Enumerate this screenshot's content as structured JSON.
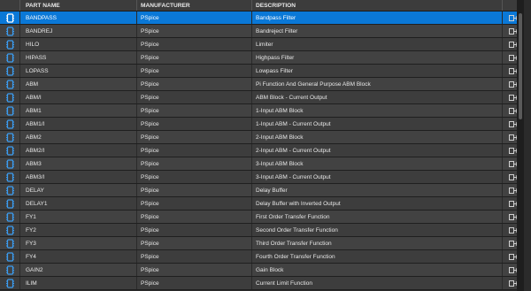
{
  "columns": {
    "part_name": "PART NAME",
    "manufacturer": "MANUFACTURER",
    "description": "DESCRIPTION"
  },
  "rows": [
    {
      "part": "BANDPASS",
      "manufacturer": "PSpice",
      "description": "Bandpass Filter",
      "selected": true
    },
    {
      "part": "BANDREJ",
      "manufacturer": "PSpice",
      "description": "Bandreject Filter"
    },
    {
      "part": "HILO",
      "manufacturer": "PSpice",
      "description": "Limiter"
    },
    {
      "part": "HIPASS",
      "manufacturer": "PSpice",
      "description": "Highpass Filter"
    },
    {
      "part": "LOPASS",
      "manufacturer": "PSpice",
      "description": "Lowpass Filter"
    },
    {
      "part": "ABM",
      "manufacturer": "PSpice",
      "description": "Pi Function And General Purpose ABM Block"
    },
    {
      "part": "ABM/I",
      "manufacturer": "PSpice",
      "description": "ABM Block - Current Output"
    },
    {
      "part": "ABM1",
      "manufacturer": "PSpice",
      "description": "1-Input ABM Block"
    },
    {
      "part": "ABM1/I",
      "manufacturer": "PSpice",
      "description": "1-Input ABM - Current Output"
    },
    {
      "part": "ABM2",
      "manufacturer": "PSpice",
      "description": "2-Input ABM Block"
    },
    {
      "part": "ABM2/I",
      "manufacturer": "PSpice",
      "description": "2-Input ABM - Current Output"
    },
    {
      "part": "ABM3",
      "manufacturer": "PSpice",
      "description": "3-Input ABM Block"
    },
    {
      "part": "ABM3/I",
      "manufacturer": "PSpice",
      "description": "3-Input ABM - Current Output"
    },
    {
      "part": "DELAY",
      "manufacturer": "PSpice",
      "description": "Delay Buffer"
    },
    {
      "part": "DELAY1",
      "manufacturer": "PSpice",
      "description": "Delay Buffer with Inverted Output"
    },
    {
      "part": "FY1",
      "manufacturer": "PSpice",
      "description": "First Order Transfer Function"
    },
    {
      "part": "FY2",
      "manufacturer": "PSpice",
      "description": "Second Order Transfer Function"
    },
    {
      "part": "FY3",
      "manufacturer": "PSpice",
      "description": "Third Order Transfer Function"
    },
    {
      "part": "FY4",
      "manufacturer": "PSpice",
      "description": "Fourth Order Transfer Function"
    },
    {
      "part": "GAIN2",
      "manufacturer": "PSpice",
      "description": "Gain Block"
    },
    {
      "part": "ILIM",
      "manufacturer": "PSpice",
      "description": "Current Limit Function"
    }
  ],
  "icons": {
    "row_icon": "part-chip-icon",
    "action_icon": "place-part-icon"
  },
  "colors": {
    "selection": "#0a78d7",
    "icon": "#3b9cf0"
  }
}
